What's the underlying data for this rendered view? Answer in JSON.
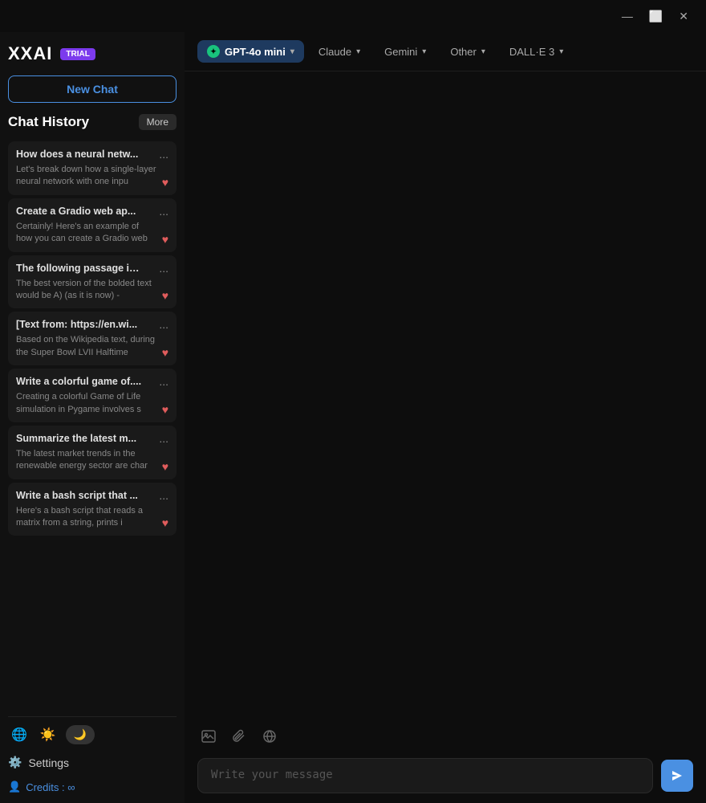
{
  "app": {
    "logo": "XXAI",
    "badge": "TRIAL"
  },
  "window_controls": {
    "minimize": "—",
    "maximize": "⬜",
    "close": "✕"
  },
  "sidebar": {
    "new_chat_label": "New Chat",
    "chat_history_label": "Chat History",
    "more_label": "More",
    "chat_items": [
      {
        "title": "How does a neural netw...",
        "preview": "Let's break down how a single-layer neural network with one inpu",
        "dots": "...",
        "favorited": true
      },
      {
        "title": "Create a Gradio web ap...",
        "preview": "Certainly! Here's an example of how you can create a Gradio web",
        "dots": "...",
        "favorited": true
      },
      {
        "title": "The following passage is....",
        "preview": "The best version of the bolded text would be A) (as it is now) -",
        "dots": "...",
        "favorited": true
      },
      {
        "title": "[Text from: https://en.wi...",
        "preview": "Based on the Wikipedia text, during the Super Bowl LVII Halftime",
        "dots": "...",
        "favorited": true
      },
      {
        "title": "Write a colorful game of....",
        "preview": "Creating a colorful Game of Life simulation in Pygame involves s",
        "dots": "...",
        "favorited": true
      },
      {
        "title": "Summarize the latest m...",
        "preview": "The latest market trends in the renewable energy sector are char",
        "dots": "...",
        "favorited": true
      },
      {
        "title": "Write a bash script that ...",
        "preview": "Here's a bash script that reads a matrix from a string, prints i",
        "dots": "...",
        "favorited": true
      }
    ],
    "settings_label": "Settings",
    "credits_label": "Credits : ∞"
  },
  "model_tabs": [
    {
      "id": "gpt4o-mini",
      "label": "GPT-4o mini",
      "active": true,
      "has_icon": true
    },
    {
      "id": "claude",
      "label": "Claude",
      "active": false
    },
    {
      "id": "gemini",
      "label": "Gemini",
      "active": false
    },
    {
      "id": "other",
      "label": "Other",
      "active": false
    },
    {
      "id": "dalle3",
      "label": "DALL·E 3",
      "active": false
    }
  ],
  "input": {
    "placeholder": "Write your message"
  }
}
